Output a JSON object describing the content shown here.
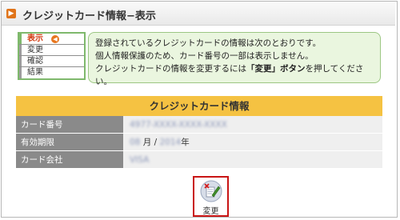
{
  "page": {
    "title": "クレジットカード情報−表示"
  },
  "steps": [
    {
      "label": "表示",
      "active": true
    },
    {
      "label": "変更",
      "active": false
    },
    {
      "label": "確認",
      "active": false
    },
    {
      "label": "結果",
      "active": false
    }
  ],
  "info": {
    "line1": "登録されているクレジットカードの情報は次のとおりです。",
    "line2": "個人情報保護のため、カード番号の一部は表示しません。",
    "line3_pre": "クレジットカードの情報を変更するには",
    "line3_strong": "「変更」ボタン",
    "line3_post": "を押してください。"
  },
  "card": {
    "header": "クレジットカード情報",
    "rows": {
      "number": {
        "label": "カード番号",
        "value": "4977-XXXX-XXXX-XXXX"
      },
      "expiry": {
        "label": "有効期限",
        "month": "08",
        "month_unit": "月",
        "sep": "/",
        "year": "2014",
        "year_unit": "年"
      },
      "company": {
        "label": "カード会社",
        "value": "VISA"
      }
    }
  },
  "buttons": {
    "change_label": "変更"
  },
  "colors": {
    "accent": "#e0741a",
    "header_bg": "#f5c242",
    "label_bg": "#8a8a8a",
    "info_bg": "#eaf6df",
    "button_border": "#c91515"
  }
}
